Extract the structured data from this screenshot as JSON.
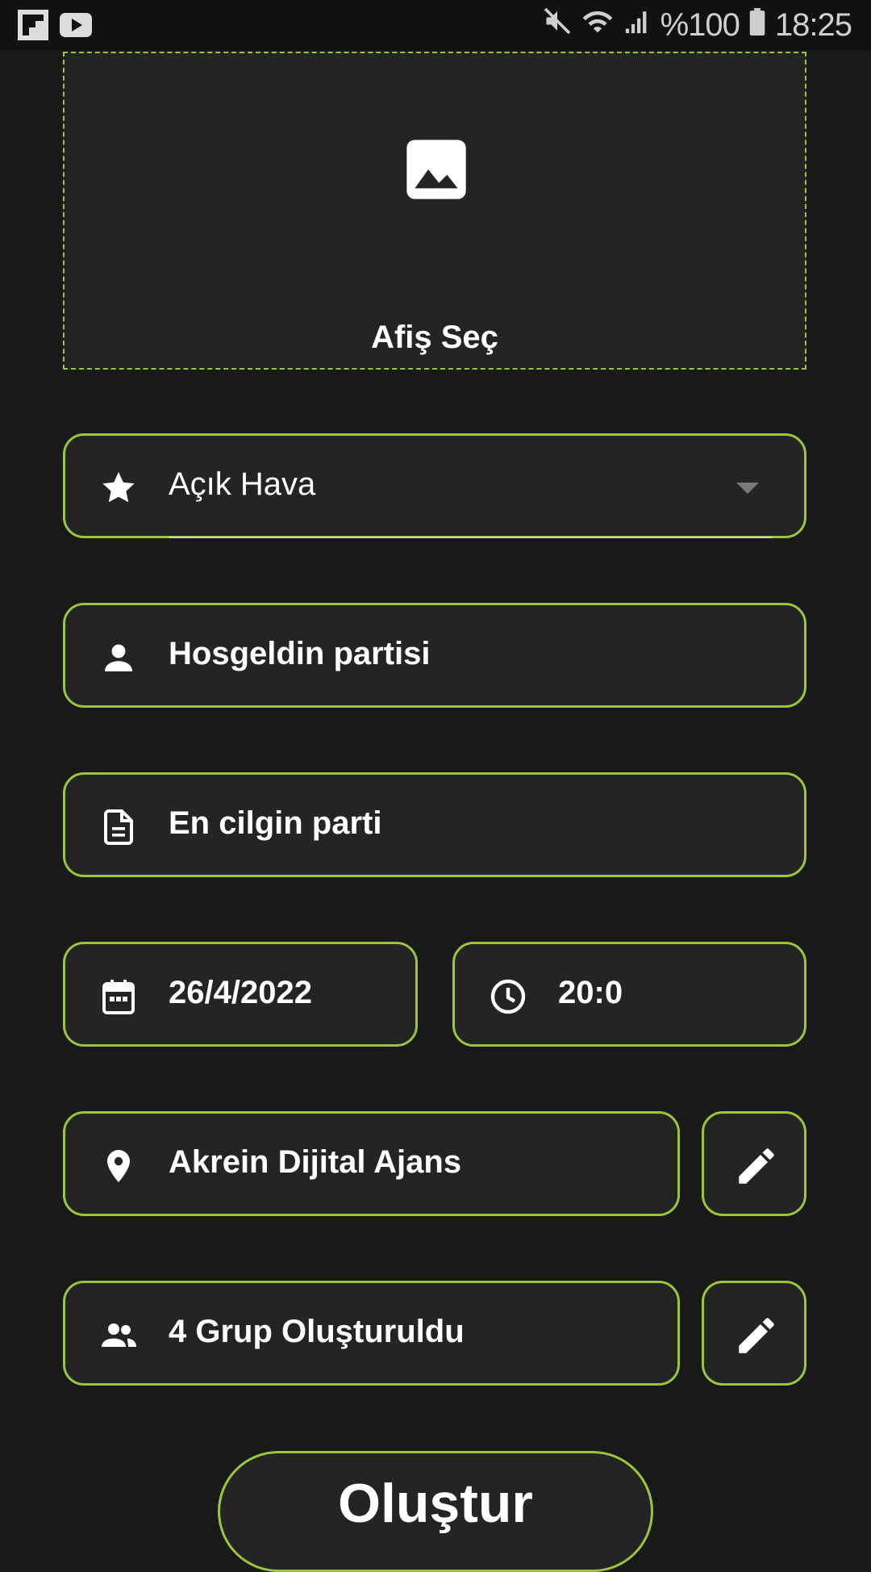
{
  "status_bar": {
    "battery": "%100",
    "time": "18:25",
    "icons": [
      "flipboard-icon",
      "youtube-icon",
      "mute-icon",
      "wifi-icon",
      "signal-icon",
      "battery-icon"
    ]
  },
  "poster": {
    "label": "Afiş Seç",
    "icon": "image-icon"
  },
  "form": {
    "category": {
      "value": "Açık Hava",
      "icon": "star-icon"
    },
    "name": {
      "value": "Hosgeldin partisi",
      "icon": "person-icon"
    },
    "description": {
      "value": "En cilgin parti",
      "icon": "document-icon"
    },
    "date": {
      "value": "26/4/2022",
      "icon": "calendar-icon"
    },
    "time": {
      "value": "20:0",
      "icon": "clock-icon"
    },
    "location": {
      "value": "Akrein Dijital Ajans",
      "icon": "location-pin-icon"
    },
    "groups": {
      "value": "4 Grup Oluşturuldu",
      "icon": "people-icon"
    }
  },
  "create_button": {
    "label": "Oluştur"
  },
  "colors": {
    "accent": "#9bc53d",
    "background": "#191919",
    "field": "#242424"
  }
}
